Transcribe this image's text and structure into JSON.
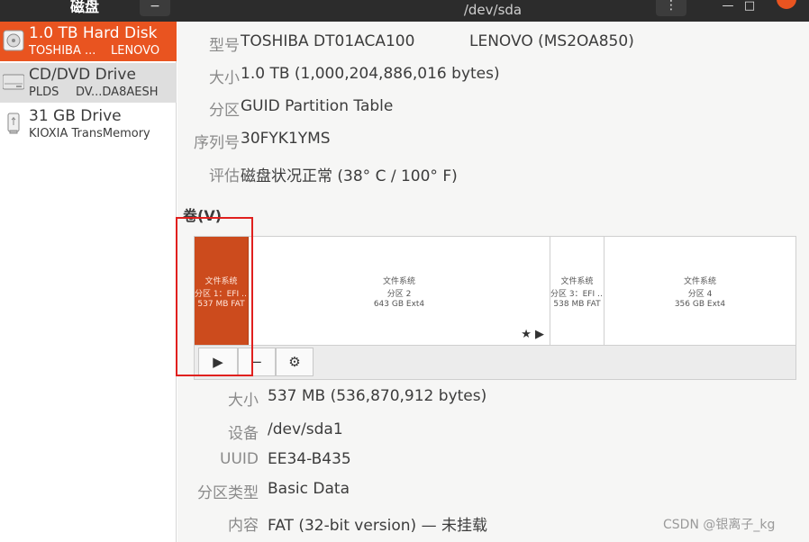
{
  "window": {
    "sidebar_title": "磁盘",
    "menu_icon": "−",
    "title": "/dev/sda",
    "more_icon": "⋮",
    "minimize_icon": "—",
    "maximize_icon": "□"
  },
  "drives": [
    {
      "name": "1.0 TB Hard Disk",
      "sub": "TOSHIBA ...",
      "sub2": "LENOVO",
      "icon": "hard-disk-icon"
    },
    {
      "name": "CD/DVD Drive",
      "sub": "PLDS",
      "sub2": "DV...DA8AESH",
      "icon": "optical-drive-icon"
    },
    {
      "name": "31 GB Drive",
      "sub": "KIOXIA TransMemory",
      "sub2": "",
      "icon": "usb-drive-icon"
    }
  ],
  "disk_info": {
    "model_label": "型号",
    "model_value": "TOSHIBA DT01ACA100",
    "model_value2": "LENOVO (MS2OA850)",
    "size_label": "大小",
    "size_value": "1.0 TB (1,000,204,886,016 bytes)",
    "partitioning_label": "分区",
    "partitioning_value": "GUID Partition Table",
    "serial_label": "序列号",
    "serial_value": "30FYK1YMS",
    "assessment_label": "评估",
    "assessment_value": "磁盘状况正常 (38° C / 100° F)"
  },
  "volumes_heading": "卷(V)",
  "volumes": [
    {
      "l1": "文件系统",
      "l2": "分区 1：EFI …",
      "l3": "537 MB FAT"
    },
    {
      "l1": "文件系统",
      "l2": "分区 2",
      "l3": "643 GB Ext4"
    },
    {
      "l1": "文件系统",
      "l2": "分区 3：EFI …",
      "l3": "538 MB FAT"
    },
    {
      "l1": "文件系统",
      "l2": "分区 4",
      "l3": "356 GB Ext4"
    }
  ],
  "volume_markers": "★ ▶",
  "toolbar": {
    "play": "▶",
    "remove": "−",
    "settings": "⚙"
  },
  "partition_info": {
    "size_label": "大小",
    "size_value": "537 MB (536,870,912 bytes)",
    "device_label": "设备",
    "device_value": "/dev/sda1",
    "uuid_label": "UUID",
    "uuid_value": "EE34-B435",
    "type_label": "分区类型",
    "type_value": "Basic Data",
    "contents_label": "内容",
    "contents_value": "FAT (32-bit version) — 未挂载"
  },
  "watermark": "CSDN @银离子_kg",
  "colors": {
    "accent": "#e95420",
    "selected_partition": "#cc4b1d",
    "highlight_box": "#e0201e"
  }
}
